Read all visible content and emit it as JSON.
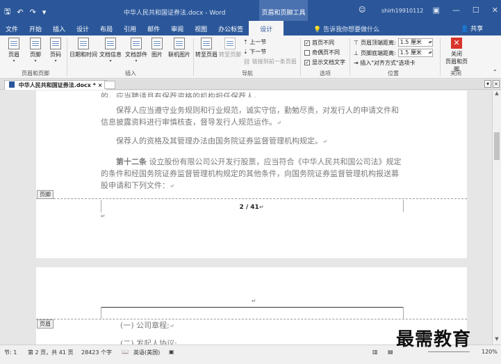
{
  "titlebar": {
    "doc_title": "中华人民共和国证券法.docx - Word",
    "context_tools": "页眉和页脚工具",
    "user": "shirh19910112",
    "qat_save": "🖫",
    "qat_undo": "↶",
    "qat_redo": "↷",
    "qat_customize": "▾",
    "win_help": "▣",
    "win_min": "—",
    "win_max": "☐",
    "win_close": "✕"
  },
  "tabs": [
    "文件",
    "开始",
    "插入",
    "设计",
    "布局",
    "引用",
    "邮件",
    "审阅",
    "视图",
    "办公标签",
    "设计"
  ],
  "active_tab_index": 10,
  "tellme": "告诉我你想要做什么",
  "share": "共享",
  "ribbon": {
    "groups": {
      "header_footer": "页眉和页脚",
      "insert": "插入",
      "nav": "导航",
      "options": "选项",
      "position": "位置",
      "close": "关闭"
    },
    "buttons": {
      "header": "页眉",
      "footer": "页脚",
      "page_number": "页码",
      "date_time": "日期和时间",
      "doc_info": "文档信息",
      "doc_parts": "文档部件",
      "picture": "图片",
      "online_picture": "联机图片",
      "goto_header": "转至页眉",
      "goto_footer": "转至页脚",
      "prev_section": "上一节",
      "next_section": "下一节",
      "link_prev": "链接到前一条页眉",
      "close_hf_line1": "关闭",
      "close_hf_line2": "页眉和页脚"
    },
    "options": {
      "diff_first": "首页不同",
      "diff_odd_even": "奇偶页不同",
      "show_text": "显示文档文字"
    },
    "position": {
      "header_top_label": "页眉顶端距离:",
      "header_top_value": "1.5 厘米",
      "footer_bottom_label": "页脚底端距离:",
      "footer_bottom_value": "1.5 厘米",
      "insert_align_tab": "插入\"对齐方式\"选项卡"
    }
  },
  "doctab": {
    "label": "中华人民共和国证券法.docx *",
    "close": "×"
  },
  "document": {
    "cut_line": "的，应当聘请具有保荐资格的机构担任保荐人。",
    "p1": "保荐人应当遵守业务规则和行业规范，诚实守信，勤勉尽责，对发行人的申请文件和信息披露资料进行审慎核查，督导发行人规范运作。",
    "p2": "保荐人的资格及其管理办法由国务院证券监督管理机构规定。",
    "p3_heading": "第十二条",
    "p3": "设立股份有限公司公开发行股票，应当符合《中华人民共和国公司法》规定的条件和经国务院证券监督管理机构规定的其他条件，向国务院证券监督管理机构报送募股申请和下列文件：",
    "footer_tag": "页脚",
    "page_number": "2 / 41",
    "header_tag": "页眉",
    "p4": "(一) 公司章程;",
    "p5": "(二) 发起人协议;",
    "para_mark": "↵"
  },
  "statusbar": {
    "section": "节: 1",
    "page": "第 2 页，共 41 页",
    "words": "28423 个字",
    "lang": "英语(美国)",
    "zoom": "120%"
  },
  "watermark": "最需教育"
}
